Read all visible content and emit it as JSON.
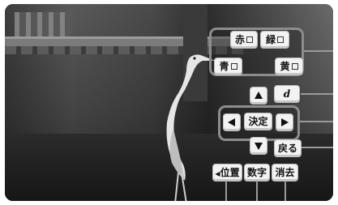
{
  "colors": {
    "button_face": "#f2f2f2",
    "panel_border": "#8d8d8d",
    "leader_line": "#9a9a9a"
  },
  "color_buttons": {
    "red": "赤",
    "green": "緑",
    "blue": "青",
    "yellow": "黄"
  },
  "nav": {
    "enter": "決定",
    "back": "戻る",
    "d_button": "d"
  },
  "bottom": {
    "position": "位置",
    "number": "数字",
    "clear": "消去"
  },
  "icons": {
    "up": "arrow-up-icon",
    "down": "arrow-down-icon",
    "left": "arrow-left-icon",
    "right": "arrow-right-icon"
  }
}
